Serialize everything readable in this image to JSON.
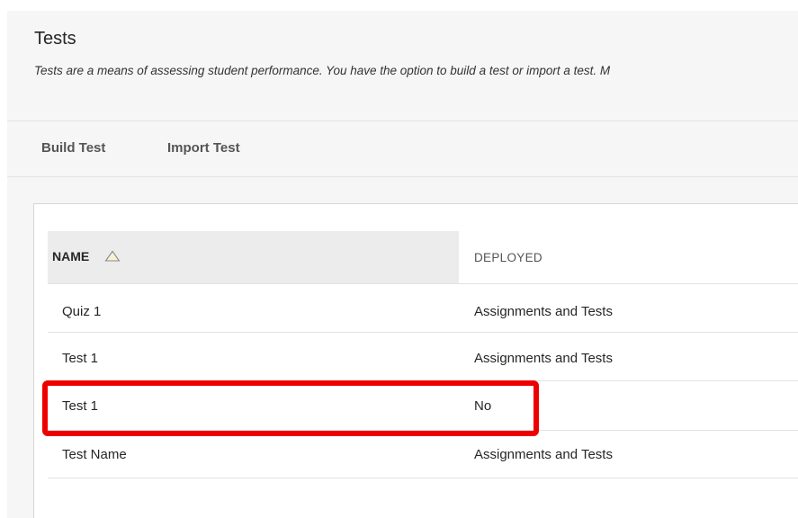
{
  "page": {
    "title": "Tests",
    "description": "Tests are a means of assessing student performance. You have the option to build a test or import a test. M"
  },
  "actions": {
    "build_test": "Build Test",
    "import_test": "Import Test"
  },
  "table": {
    "headers": {
      "name": "NAME",
      "deployed": "DEPLOYED"
    },
    "sort": {
      "column": "name",
      "direction": "ascending"
    },
    "rows": [
      {
        "name": "Quiz 1",
        "deployed": "Assignments and Tests"
      },
      {
        "name": "Test 1",
        "deployed": "Assignments and Tests"
      },
      {
        "name": "Test 1",
        "deployed": "No"
      },
      {
        "name": "Test Name",
        "deployed": "Assignments and Tests"
      }
    ],
    "highlighted_row": 2
  },
  "colors": {
    "highlight": "#ee0000",
    "header_bg": "#ececec",
    "page_bg": "#f6f6f6"
  }
}
